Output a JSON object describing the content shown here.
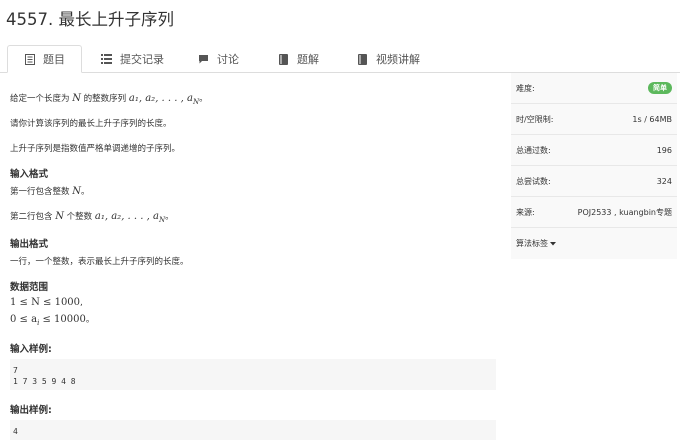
{
  "problem": {
    "title": "4557. 最长上升子序列"
  },
  "tabs": [
    {
      "label": "题目",
      "icon": "document-icon"
    },
    {
      "label": "提交记录",
      "icon": "list-icon"
    },
    {
      "label": "讨论",
      "icon": "comment-icon"
    },
    {
      "label": "题解",
      "icon": "book-icon"
    },
    {
      "label": "视频讲解",
      "icon": "book-icon"
    }
  ],
  "statement": {
    "line1_pre": "给定一个长度为",
    "line1_var": "N",
    "line1_mid": "的整数序列",
    "line1_math": "a₁, a₂, . . . , a",
    "line1_sub": "N",
    "line1_end": "。",
    "line2": "请你计算该序列的最长上升子序列的长度。",
    "line3": "上升子序列是指数值严格单调递增的子序列。"
  },
  "input_format": {
    "heading": "输入格式",
    "line1_pre": "第一行包含整数",
    "line1_var": "N",
    "line1_end": "。",
    "line2_pre": "第二行包含",
    "line2_var": "N",
    "line2_mid": "个整数",
    "line2_math": "a₁, a₂, . . . , a",
    "line2_sub": "N",
    "line2_end": "。"
  },
  "output_format": {
    "heading": "输出格式",
    "line1": "一行，一个整数，表示最长上升子序列的长度。"
  },
  "range": {
    "heading": "数据范围",
    "line1": "1 ≤ N ≤ 1000",
    "line1_end": ",",
    "line2_pre": "0 ≤ a",
    "line2_sub": "i",
    "line2_post": " ≤ 10000",
    "line2_end": "。"
  },
  "sample_input": {
    "heading": "输入样例:",
    "lines": [
      "7",
      "1 7 3 5 9 4 8"
    ]
  },
  "sample_output": {
    "heading": "输出样例:",
    "lines": [
      "4"
    ]
  },
  "sidebar": {
    "difficulty_label": "难度:",
    "difficulty_value": "简单",
    "difficulty_color": "#5cb85c",
    "limit_label": "时/空限制:",
    "limit_value": "1s / 64MB",
    "accepted_label": "总通过数:",
    "accepted_value": "196",
    "attempts_label": "总尝试数:",
    "attempts_value": "324",
    "source_label": "来源:",
    "source_value": "POJ2533 , kuangbin专题",
    "tags_label": "算法标签"
  }
}
